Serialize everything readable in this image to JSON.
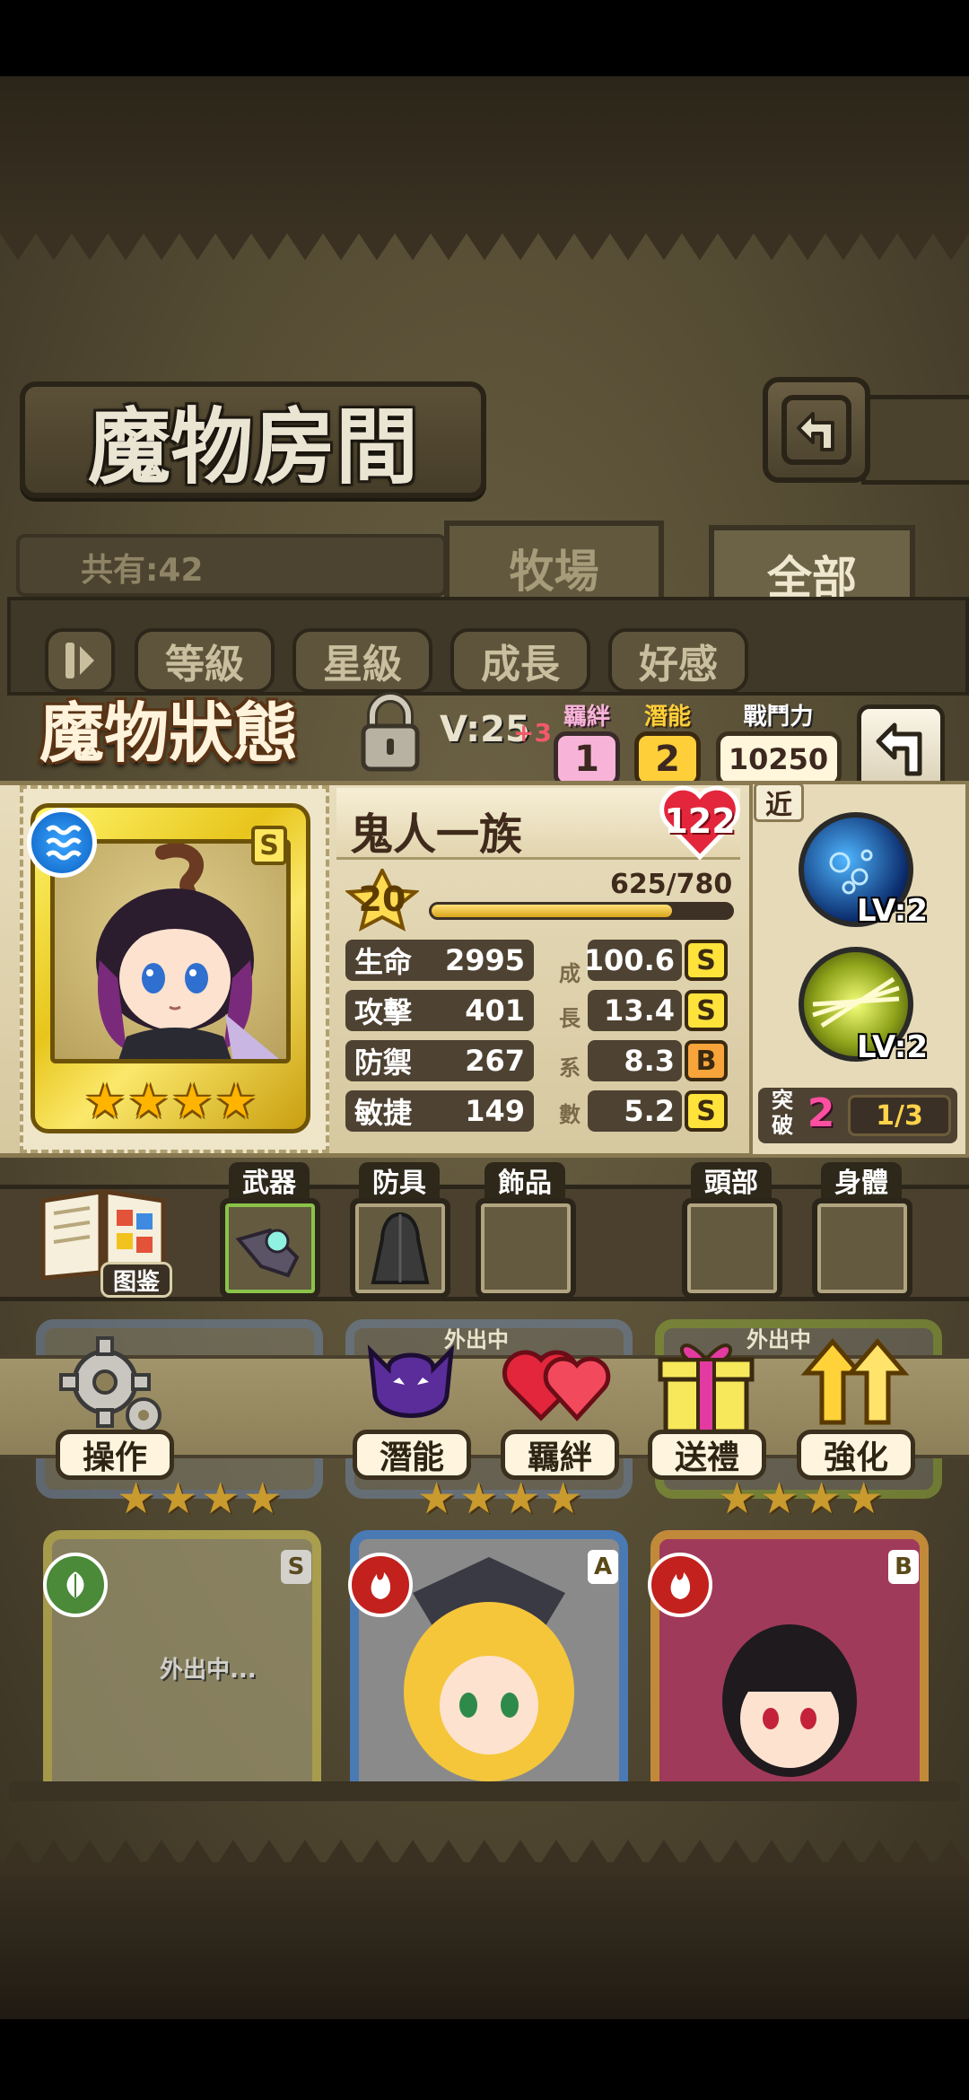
{
  "header": {
    "title": "魔物房間"
  },
  "collection": {
    "count_text": "共有:42"
  },
  "tabs": [
    {
      "label": "牧場"
    },
    {
      "label": "全部"
    }
  ],
  "sort_buttons": [
    {
      "label": "等級"
    },
    {
      "label": "星級"
    },
    {
      "label": "成長"
    },
    {
      "label": "好感"
    }
  ],
  "status": {
    "title": "魔物狀態",
    "level_text": "V:25",
    "level_plus": "+3",
    "bond": {
      "label": "羈絆",
      "value": "1"
    },
    "potential": {
      "label": "潛能",
      "value": "2"
    },
    "power": {
      "label": "戰鬥力",
      "value": "10250"
    }
  },
  "monster": {
    "name": "鬼人一族",
    "rank": "S",
    "affection": "122",
    "level": "20",
    "exp_text": "625/780",
    "exp_fraction": 0.801,
    "stars": 4,
    "element_icon": "water-icon",
    "growth_label": [
      "成",
      "長",
      "系",
      "數"
    ],
    "stats": [
      {
        "label": "生命",
        "value": "2995",
        "growth": "100.6",
        "grade": "S"
      },
      {
        "label": "攻擊",
        "value": "401",
        "growth": "13.4",
        "grade": "S"
      },
      {
        "label": "防禦",
        "value": "267",
        "growth": "8.3",
        "grade": "B"
      },
      {
        "label": "敏捷",
        "value": "149",
        "growth": "5.2",
        "grade": "S"
      }
    ]
  },
  "skills": {
    "range_label": "近",
    "items": [
      {
        "lv": "LV:2"
      },
      {
        "lv": "LV:2"
      }
    ],
    "breakthrough": {
      "label_line1": "突",
      "label_line2": "破",
      "value": "2",
      "progress": "1/3"
    }
  },
  "equipment": {
    "codex_label": "图鉴",
    "slots": [
      {
        "label": "武器"
      },
      {
        "label": "防具"
      },
      {
        "label": "飾品"
      },
      {
        "label": "頭部"
      },
      {
        "label": "身體"
      }
    ]
  },
  "actions": [
    {
      "label": "操作"
    },
    {
      "label": "潛能"
    },
    {
      "label": "羈絆"
    },
    {
      "label": "送禮"
    },
    {
      "label": "強化"
    }
  ],
  "grid": {
    "away_text": "外出中",
    "away_text_2": "外出中...",
    "card_ranks": [
      "S",
      "A",
      "B"
    ]
  },
  "colors": {
    "accent_gold": "#f2c21e",
    "grade_s": "#ffe23a",
    "grade_b": "#f7a43a",
    "bond_pink": "#f7b4d8",
    "potential_gold": "#ffcf3a"
  }
}
